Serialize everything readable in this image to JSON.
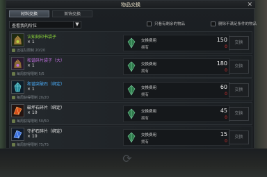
{
  "window": {
    "title": "物品交换",
    "close_label": "✕"
  },
  "tabs": [
    {
      "label": "材料交换",
      "active": true
    },
    {
      "label": "首饰交换",
      "active": false
    }
  ],
  "filters": {
    "dropdown_label": "查看我的阶位",
    "dropdown_arrow": "▼",
    "check_remaining": "只看有剩余的物品",
    "check_delete_unmet": "删除不满足条件的物品"
  },
  "labels": {
    "cost": "交换费用",
    "owned": "拥有",
    "exchange_button": "交换"
  },
  "items": [
    {
      "name": "认知刻印书袋子",
      "name_color": "#8fdc3a",
      "qty": "× 1",
      "limit": "远征队限制 20/20",
      "icon": "bag-icon",
      "cost": "150",
      "owned": "0"
    },
    {
      "name": "和谐碎片袋子（大）",
      "name_color": "#c070e0",
      "qty": "× 1",
      "limit": "每周获得限制 5/5",
      "icon": "bag-icon",
      "cost": "180",
      "owned": "0"
    },
    {
      "name": "和谐突破石（绑定）",
      "name_color": "#4ab0ff",
      "qty": "× 1",
      "limit": "每周获得限制 20/20",
      "icon": "crystal-icon",
      "cost": "60",
      "owned": "0"
    },
    {
      "name": "破坏石碎片（绑定）",
      "name_color": "#e8e8e8",
      "qty": "× 10",
      "limit": "每周获得限制 50/50",
      "icon": "red-shard-icon",
      "cost": "45",
      "owned": "0"
    },
    {
      "name": "守护石碎片（绑定）",
      "name_color": "#e8e8e8",
      "qty": "× 10",
      "limit": "每周获得限制 75/75",
      "icon": "blue-shard-icon",
      "cost": "15",
      "owned": "0"
    }
  ]
}
